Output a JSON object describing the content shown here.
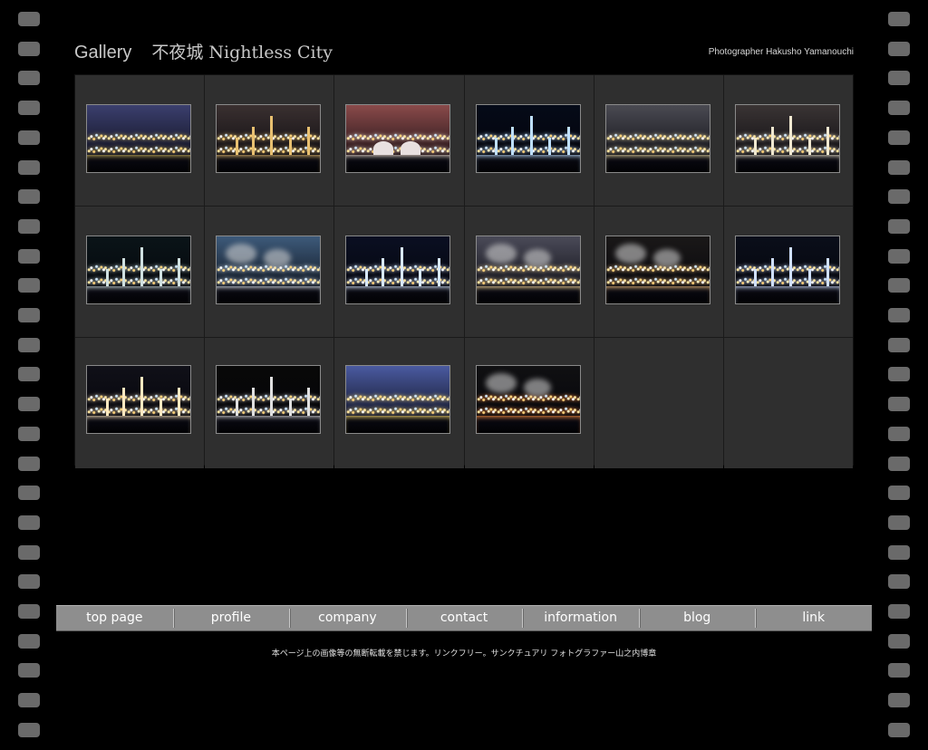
{
  "header": {
    "title": "Gallery",
    "subtitle": "不夜城 Nightless City",
    "photographer": "Photographer Hakusho Yamanouchi"
  },
  "gallery": {
    "thumbnails": [
      {
        "sky": "#3b3f6e",
        "glow": "#c9b35a",
        "style": "city"
      },
      {
        "sky": "#3a3030",
        "glow": "#e8c070",
        "style": "plant"
      },
      {
        "sky": "#8a4a4a",
        "glow": "#f0e0d0",
        "style": "tanks"
      },
      {
        "sky": "#050a18",
        "glow": "#bfe0ff",
        "style": "towers"
      },
      {
        "sky": "#4a4a52",
        "glow": "#e8d8a0",
        "style": "city"
      },
      {
        "sky": "#3a3434",
        "glow": "#f0e8d0",
        "style": "plant"
      },
      {
        "sky": "#0a1418",
        "glow": "#cfe0e0",
        "style": "dome"
      },
      {
        "sky": "#3d5a7a",
        "glow": "#e0e8f0",
        "style": "steam"
      },
      {
        "sky": "#0a0f22",
        "glow": "#d8e8ff",
        "style": "towers"
      },
      {
        "sky": "#4a4a58",
        "glow": "#ffe0a0",
        "style": "steam"
      },
      {
        "sky": "#1a1818",
        "glow": "#f0c080",
        "style": "steam"
      },
      {
        "sky": "#0a0e1a",
        "glow": "#d0e0ff",
        "style": "towers"
      },
      {
        "sky": "#101018",
        "glow": "#ffe8c0",
        "style": "plant"
      },
      {
        "sky": "#080808",
        "glow": "#e0e0e0",
        "style": "towers"
      },
      {
        "sky": "#4a5aa0",
        "glow": "#ffe070",
        "style": "city"
      },
      {
        "sky": "#101012",
        "glow": "#ff9040",
        "style": "steam"
      }
    ],
    "columns": 6,
    "rows": 3
  },
  "nav": {
    "items": [
      {
        "label": "top page",
        "name": "nav-top-page"
      },
      {
        "label": "profile",
        "name": "nav-profile"
      },
      {
        "label": "company",
        "name": "nav-company"
      },
      {
        "label": "contact",
        "name": "nav-contact"
      },
      {
        "label": "information",
        "name": "nav-information"
      },
      {
        "label": "blog",
        "name": "nav-blog"
      },
      {
        "label": "link",
        "name": "nav-link"
      }
    ]
  },
  "footer": {
    "text": "本ページ上の画像等の無断転載を禁じます。リンクフリー。サンクチュアリ フォトグラファー山之内博章"
  },
  "colors": {
    "background": "#000000",
    "panel": "#2f2f2f",
    "nav": "#8e8e8e",
    "perforation": "#6a6a6a"
  }
}
